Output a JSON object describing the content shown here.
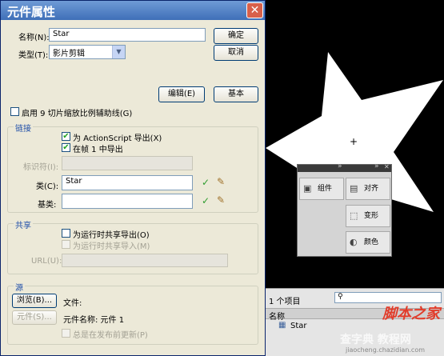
{
  "dialog": {
    "title": "元件属性",
    "close_glyph": "✕",
    "name_label": "名称(N):",
    "name_value": "Star",
    "type_label": "类型(T):",
    "type_value": "影片剪辑",
    "ok_button": "确定",
    "cancel_button": "取消",
    "edit_button": "编辑(E)",
    "basic_button": "基本",
    "enable_9slice_label": "启用 9 切片缩放比例辅助线(G)",
    "enable_9slice_checked": false,
    "linkage": {
      "title": "链接",
      "export_as_label": "为 ActionScript 导出(X)",
      "export_as_checked": true,
      "export_first_frame_label": "在帧 1 中导出",
      "export_first_frame_checked": true,
      "identifier_label": "标识符(I):",
      "identifier_value": "",
      "class_label": "类(C):",
      "class_value": "Star",
      "base_class_label": "基类:",
      "base_class_value": ""
    },
    "sharing": {
      "title": "共享",
      "export_runtime_label": "为运行时共享导出(O)",
      "export_runtime_checked": false,
      "import_runtime_label": "为运行时共享导入(M)",
      "import_runtime_checked": false,
      "url_label": "URL(U):",
      "url_value": ""
    },
    "source": {
      "title": "源",
      "browse_button": "浏览(B)...",
      "symbol_button": "元件(S)...",
      "file_label": "文件:",
      "symbol_name_label": "元件名称: 元件 1",
      "always_update_label": "总是在发布前更新(P)",
      "always_update_checked": false
    }
  },
  "panel": {
    "items": [
      "组件",
      "对齐",
      "变形",
      "颜色"
    ],
    "collapse_glyph": "»",
    "close_glyph": "✕"
  },
  "library": {
    "item_count": "1 个项目",
    "name_header": "名称",
    "item_name": "Star"
  },
  "watermark": {
    "brand": "脚本之家",
    "site_cn": "查字典 教程网",
    "site_url": "jiaocheng.chazidian.com"
  },
  "stage": {
    "background": "#000000",
    "star_color": "#ffffff"
  }
}
